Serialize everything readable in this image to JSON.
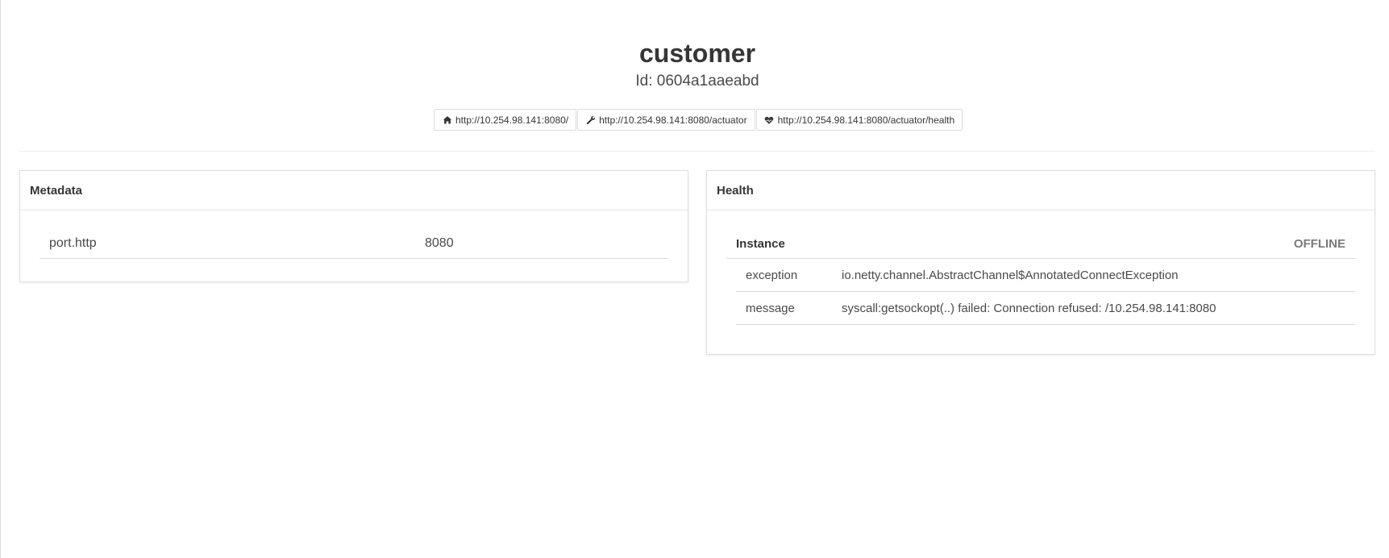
{
  "header": {
    "app_name": "customer",
    "instance_id": "Id: 0604a1aaeabd"
  },
  "links": [
    {
      "icon": "home-icon",
      "label": "http://10.254.98.141:8080/"
    },
    {
      "icon": "wrench-icon",
      "label": "http://10.254.98.141:8080/actuator"
    },
    {
      "icon": "heartbeat-icon",
      "label": "http://10.254.98.141:8080/actuator/health"
    }
  ],
  "metadata": {
    "title": "Metadata",
    "rows": [
      {
        "key": "port.http",
        "value": "8080"
      }
    ]
  },
  "health": {
    "title": "Health",
    "instance_label": "Instance",
    "status": "OFFLINE",
    "details": [
      {
        "key": "exception",
        "value": "io.netty.channel.AbstractChannel$AnnotatedConnectException"
      },
      {
        "key": "message",
        "value": "syscall:getsockopt(..) failed: Connection refused: /10.254.98.141:8080"
      }
    ]
  }
}
